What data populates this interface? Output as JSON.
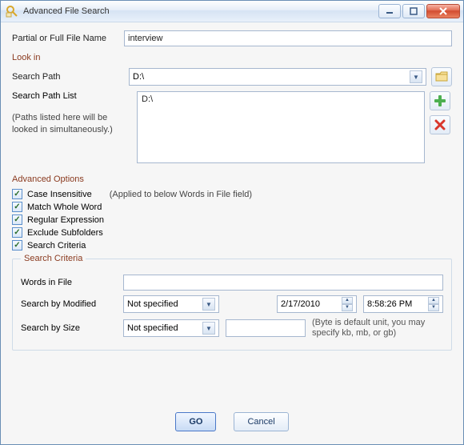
{
  "window": {
    "title": "Advanced File Search"
  },
  "filename": {
    "label": "Partial or Full File Name",
    "value": "interview"
  },
  "lookin": {
    "title": "Look in",
    "path_label": "Search Path",
    "path_value": "D:\\",
    "list_label": "Search Path List",
    "list_value": "D:\\",
    "hint1": "(Paths listed here will be",
    "hint2": "looked in simultaneously.)"
  },
  "advanced": {
    "title": "Advanced Options",
    "case": "Case Insensitive",
    "applied": "(Applied to below Words in File field)",
    "whole": "Match Whole Word",
    "regex": "Regular Expression",
    "exclude": "Exclude Subfolders",
    "criteria_chk": "Search Criteria"
  },
  "criteria": {
    "legend": "Search Criteria",
    "words_label": "Words in File",
    "words_value": "",
    "modified_label": "Search by Modified",
    "modified_value": "Not specified",
    "date_value": "2/17/2010",
    "time_value": "8:58:26 PM",
    "size_label": "Search by Size",
    "size_sel": "Not specified",
    "size_value": "",
    "size_hint": "(Byte is default unit, you may specify kb, mb, or gb)"
  },
  "buttons": {
    "go": "GO",
    "cancel": "Cancel"
  }
}
